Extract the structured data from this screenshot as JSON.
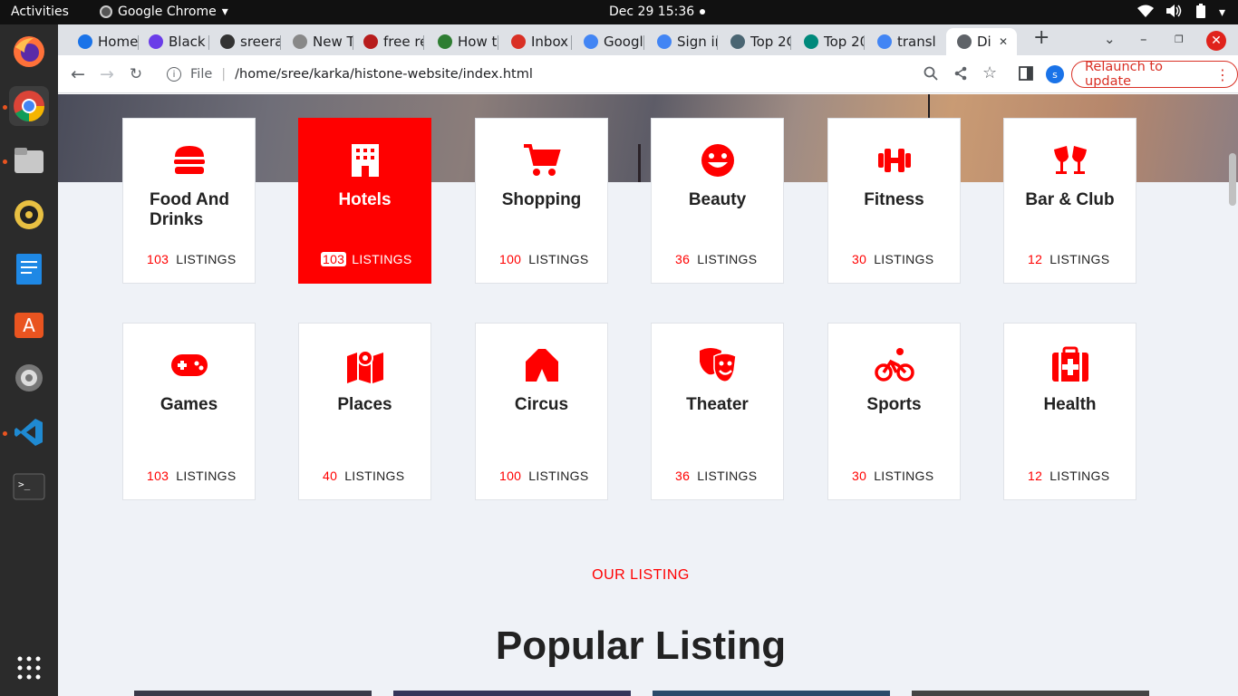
{
  "topbar": {
    "activities": "Activities",
    "app_name": "Google Chrome",
    "clock": "Dec 29  15:36"
  },
  "tabs": [
    {
      "label": "Home",
      "color": "#1a73e8"
    },
    {
      "label": "Black",
      "color": "#6a3de8"
    },
    {
      "label": "sreera",
      "color": "#333333"
    },
    {
      "label": "New T",
      "color": "#888888"
    },
    {
      "label": "free re",
      "color": "#b71c1c"
    },
    {
      "label": "How t",
      "color": "#2e7d32"
    },
    {
      "label": "Inbox",
      "color": "#d93025"
    },
    {
      "label": "Googl",
      "color": "#4285f4"
    },
    {
      "label": "Sign ir",
      "color": "#4285f4"
    },
    {
      "label": "Top 2C",
      "color": "#4a6572"
    },
    {
      "label": "Top 20",
      "color": "#00897b"
    },
    {
      "label": "transl",
      "color": "#4285f4"
    },
    {
      "label": "Di",
      "color": "#5f6368"
    }
  ],
  "toolbar": {
    "file_label": "File",
    "url": "/home/sree/karka/histone-website/index.html",
    "profile_initial": "s",
    "relaunch_label": "Relaunch to update"
  },
  "categories_row1": [
    {
      "title": "Food And Drinks",
      "count": "103",
      "suffix": "LISTINGS",
      "icon": "burger-icon",
      "selected": false
    },
    {
      "title": "Hotels",
      "count": "103",
      "suffix": "LISTINGS",
      "icon": "hotel-icon",
      "selected": true
    },
    {
      "title": "Shopping",
      "count": "100",
      "suffix": "LISTINGS",
      "icon": "cart-icon",
      "selected": false
    },
    {
      "title": "Beauty",
      "count": "36",
      "suffix": "LISTINGS",
      "icon": "smile-icon",
      "selected": false
    },
    {
      "title": "Fitness",
      "count": "30",
      "suffix": "LISTINGS",
      "icon": "dumbbell-icon",
      "selected": false
    },
    {
      "title": "Bar & Club",
      "count": "12",
      "suffix": "LISTINGS",
      "icon": "glasses-icon",
      "selected": false
    }
  ],
  "categories_row2": [
    {
      "title": "Games",
      "count": "103",
      "suffix": "LISTINGS",
      "icon": "gamepad-icon",
      "selected": false
    },
    {
      "title": "Places",
      "count": "40",
      "suffix": "LISTINGS",
      "icon": "map-icon",
      "selected": false
    },
    {
      "title": "Circus",
      "count": "100",
      "suffix": "LISTINGS",
      "icon": "tent-icon",
      "selected": false
    },
    {
      "title": "Theater",
      "count": "36",
      "suffix": "LISTINGS",
      "icon": "masks-icon",
      "selected": false
    },
    {
      "title": "Sports",
      "count": "30",
      "suffix": "LISTINGS",
      "icon": "bicycle-icon",
      "selected": false
    },
    {
      "title": "Health",
      "count": "12",
      "suffix": "LISTINGS",
      "icon": "medkit-icon",
      "selected": false
    }
  ],
  "section": {
    "eyebrow": "OUR LISTING",
    "title": "Popular Listing"
  },
  "colors": {
    "accent": "#ff0000",
    "page_bg": "#eff2f7"
  }
}
